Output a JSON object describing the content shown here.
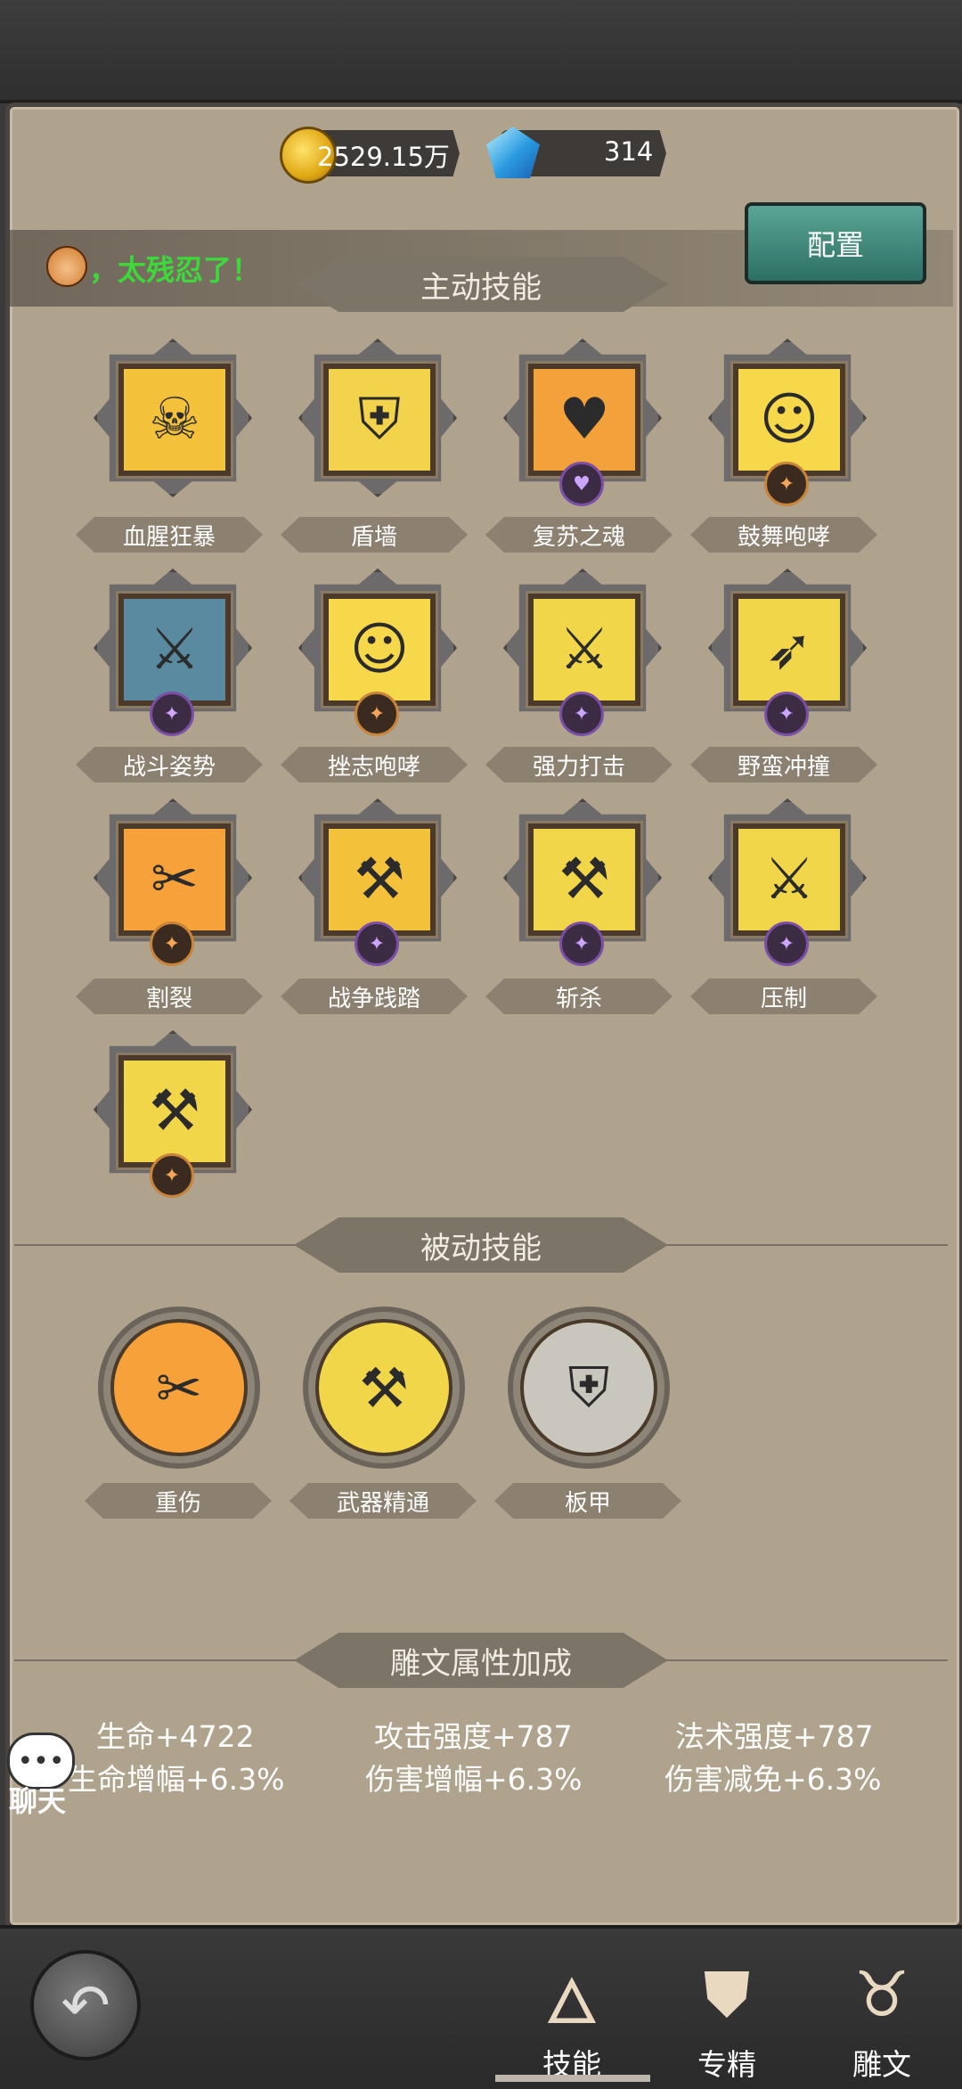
{
  "currency": {
    "gold": "2529.15万",
    "gems": "314"
  },
  "config_button": "配置",
  "message": "，太残忍了！",
  "active_title": "主动技能",
  "active_skills": [
    {
      "name": "血腥狂暴",
      "icon": "skull-icon",
      "glyph": "☠",
      "bg": "#f4c13b",
      "badge": null
    },
    {
      "name": "盾墙",
      "icon": "shield-icon",
      "glyph": "⛨",
      "bg": "#f3d34b",
      "badge": null
    },
    {
      "name": "复苏之魂",
      "icon": "muscle-warrior-icon",
      "glyph": "♥",
      "bg": "#f3a13a",
      "badge": "heart"
    },
    {
      "name": "鼓舞咆哮",
      "icon": "roaring-face-icon",
      "glyph": "☺",
      "bg": "#f6d84a",
      "badge": "bronze"
    },
    {
      "name": "战斗姿势",
      "icon": "crossed-maces-icon",
      "glyph": "⚔",
      "bg": "#5a8aa0",
      "badge": "purple"
    },
    {
      "name": "挫志咆哮",
      "icon": "roaring-face-icon",
      "glyph": "☺",
      "bg": "#f6d84a",
      "badge": "bronze"
    },
    {
      "name": "强力打击",
      "icon": "sword-strike-icon",
      "glyph": "⚔",
      "bg": "#f1d64a",
      "badge": "purple"
    },
    {
      "name": "野蛮冲撞",
      "icon": "charge-icon",
      "glyph": "➶",
      "bg": "#f1d64a",
      "badge": "purple"
    },
    {
      "name": "割裂",
      "icon": "rend-slash-icon",
      "glyph": "✂",
      "bg": "#f6a13a",
      "badge": "bronze"
    },
    {
      "name": "战争践踏",
      "icon": "hammer-icon",
      "glyph": "⚒",
      "bg": "#f4c13b",
      "badge": "purple"
    },
    {
      "name": "斩杀",
      "icon": "execute-axe-icon",
      "glyph": "⚒",
      "bg": "#f1d64a",
      "badge": "purple"
    },
    {
      "name": "压制",
      "icon": "overpower-sword-icon",
      "glyph": "⚔",
      "bg": "#f1d64a",
      "badge": "purple"
    },
    {
      "name": "",
      "icon": "axe-icon",
      "glyph": "⚒",
      "bg": "#f1d64a",
      "badge": "bronze"
    }
  ],
  "passive_title": "被动技能",
  "passive_skills": [
    {
      "name": "重伤",
      "icon": "deep-wound-icon",
      "glyph": "✂",
      "bg": "#f6a13a"
    },
    {
      "name": "武器精通",
      "icon": "axe-icon",
      "glyph": "⚒",
      "bg": "#f1d64a"
    },
    {
      "name": "板甲",
      "icon": "plate-armor-icon",
      "glyph": "⛨",
      "bg": "#c9c6bd"
    }
  ],
  "glyph_title": "雕文属性加成",
  "stats": [
    [
      "生命+4722",
      "攻击强度+787",
      "法术强度+787"
    ],
    [
      "生命增幅+6.3%",
      "伤害增幅+6.3%",
      "伤害减免+6.3%"
    ]
  ],
  "chat_label": "聊天",
  "nav": {
    "skills": "技能",
    "specialization": "专精",
    "glyphs": "雕文"
  }
}
